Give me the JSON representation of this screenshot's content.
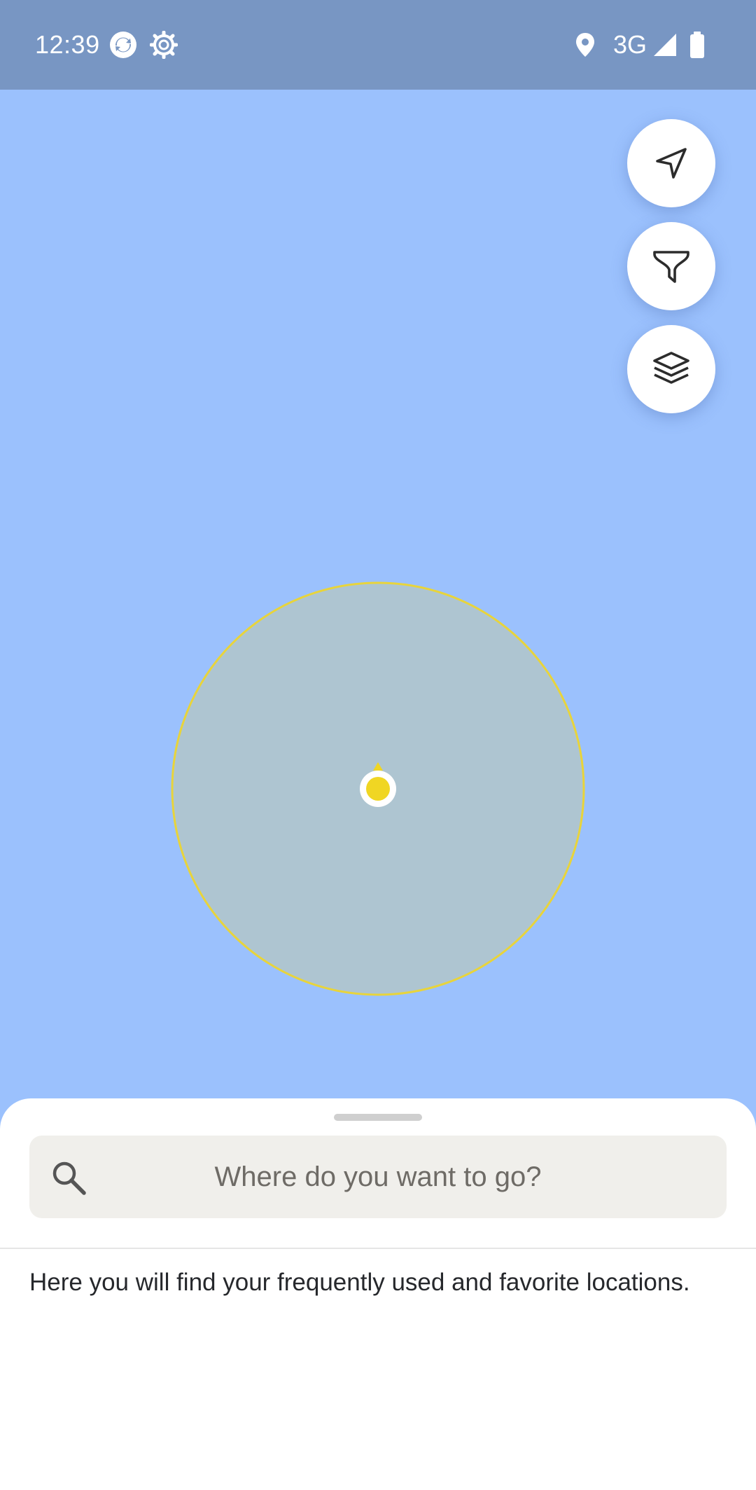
{
  "status_bar": {
    "time": "12:39",
    "network": "3G",
    "icons": [
      "sync-icon",
      "settings-gear-icon",
      "location-pin-icon",
      "signal-icon",
      "battery-icon"
    ]
  },
  "map": {
    "background_color": "#9bc1fd",
    "accuracy_fill": "#aec5d1",
    "accuracy_stroke": "#e8d43b",
    "location_dot_color": "#f0d623"
  },
  "map_controls": {
    "buttons": [
      {
        "name": "my-location-button",
        "icon": "navigation-arrow-icon"
      },
      {
        "name": "filter-button",
        "icon": "filter-icon"
      },
      {
        "name": "layers-button",
        "icon": "layers-icon"
      }
    ]
  },
  "bottom_sheet": {
    "search": {
      "placeholder": "Where do you want to go?",
      "icon": "search-icon"
    },
    "empty_state_text": "Here you will find your frequently used and favorite locations."
  }
}
